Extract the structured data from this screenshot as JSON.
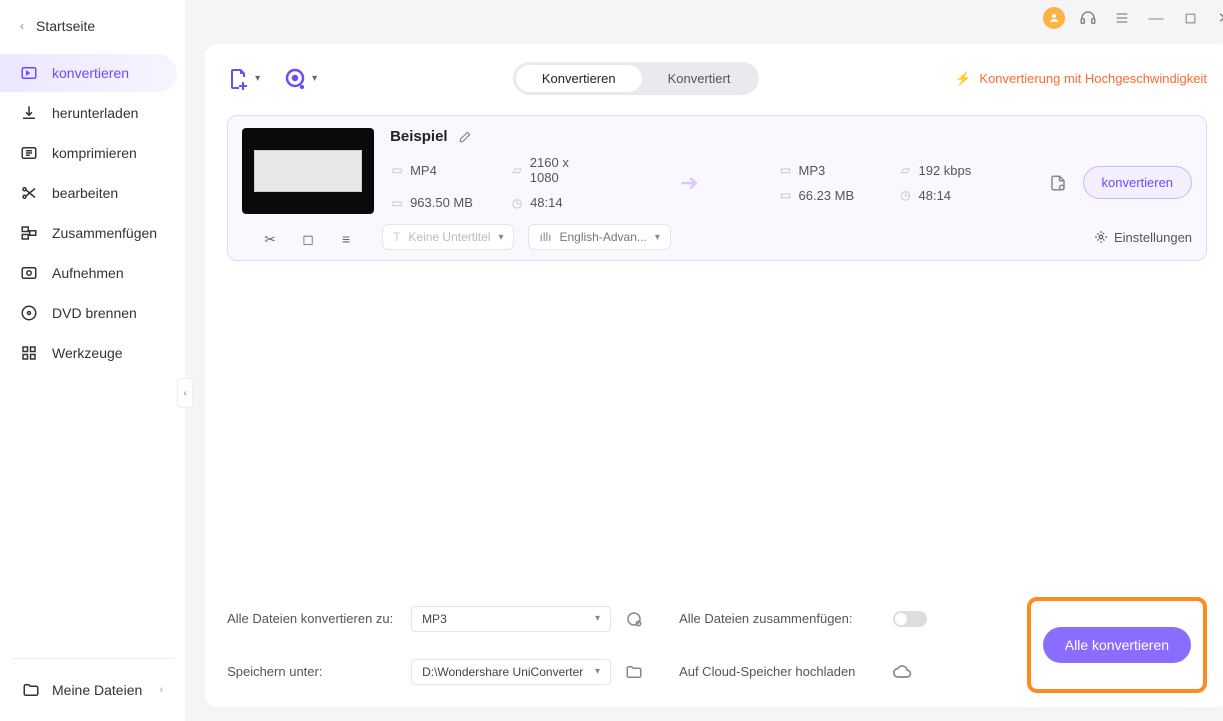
{
  "sidebar": {
    "home": "Startseite",
    "items": [
      {
        "label": "konvertieren"
      },
      {
        "label": "herunterladen"
      },
      {
        "label": "komprimieren"
      },
      {
        "label": "bearbeiten"
      },
      {
        "label": "Zusammenfügen"
      },
      {
        "label": "Aufnehmen"
      },
      {
        "label": "DVD brennen"
      },
      {
        "label": "Werkzeuge"
      }
    ],
    "my_files": "Meine Dateien"
  },
  "tabs": {
    "convert": "Konvertieren",
    "converted": "Konvertiert"
  },
  "speed_label": "Konvertierung mit Hochgeschwindigkeit",
  "file": {
    "title": "Beispiel",
    "src_format": "MP4",
    "src_res": "2160 x 1080",
    "src_size": "963.50 MB",
    "src_dur": "48:14",
    "dst_format": "MP3",
    "dst_bitrate": "192 kbps",
    "dst_size": "66.23 MB",
    "dst_dur": "48:14",
    "convert_label": "konvertieren",
    "subtitle_placeholder": "Keine Untertitel",
    "audio_track": "English-Advan...",
    "settings_label": "Einstellungen"
  },
  "bottom": {
    "convert_all_to": "Alle Dateien konvertieren zu:",
    "target_format": "MP3",
    "save_to": "Speichern unter:",
    "save_path": "D:\\Wondershare UniConverter",
    "merge_label": "Alle Dateien zusammenfügen:",
    "cloud_label": "Auf Cloud-Speicher hochladen",
    "convert_all_btn": "Alle konvertieren"
  }
}
